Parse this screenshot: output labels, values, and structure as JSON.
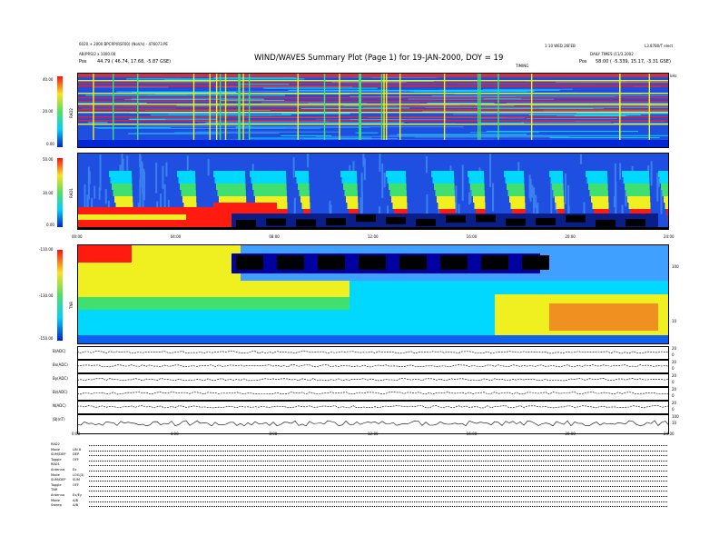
{
  "header": {
    "title": "WIND/WAVES Summary Plot (Page 1) for 19-JAN-2000, DOY = 19",
    "left_line1": "6020 + 2000 BPCRP(RSF00) (NoV/s) - 476073.PE",
    "left_line2": "AB(PRS)2 x 1000.00",
    "left_pos_label": "Pos",
    "left_pos_value": "44.79 ( 46.74, 17.68, -5.87 GSE)",
    "right_line1": "1:10 WED 26FEB",
    "right_line1b": "L3.8780/T elect",
    "right_line2": "DAILY TIMES (11/3.2002",
    "right_pos_label": "Pos",
    "right_pos_value": "58.00 ( -5.339, 15.17, -3.31 GSE)",
    "timing_label": "TIMING",
    "khz_label": "kHz"
  },
  "colors": {
    "bg_blue": "#1f4fe0",
    "deep_blue": "#0026d6",
    "cyan": "#00d8ff",
    "green": "#40e070",
    "yellow": "#f0f020",
    "red": "#ff1b10",
    "black": "#000000"
  },
  "chart_data": [
    {
      "type": "heatmap",
      "name": "RAD2",
      "ylabel": "RAD2",
      "yticks": [
        "40.00",
        "20.00",
        "0.00"
      ],
      "xticks": [
        "00:00",
        "04:00",
        "08:00",
        "12:00",
        "16:00",
        "20:00",
        "24:00"
      ]
    },
    {
      "type": "heatmap",
      "name": "RAD1",
      "ylabel": "RAD1",
      "yticks": [
        "50.00",
        "30.00",
        "0.00"
      ]
    },
    {
      "type": "heatmap",
      "name": "TNR",
      "ylabel": "TNR",
      "yticks": [
        "-110.00",
        "-130.00",
        "-150.00"
      ],
      "right_ticks": [
        "100",
        "10"
      ]
    },
    {
      "type": "line",
      "name": "magnetometer",
      "panels": [
        {
          "label": "B(ADC)",
          "right_ticks": [
            "20",
            "0"
          ]
        },
        {
          "label": "Bx(ADC)",
          "right_ticks": [
            "20",
            "0"
          ]
        },
        {
          "label": "By(ADC)",
          "right_ticks": [
            "20",
            "0"
          ]
        },
        {
          "label": "Bz(ADC)",
          "right_ticks": [
            "20",
            "0"
          ]
        },
        {
          "label": "N(ADC)",
          "right_ticks": [
            "20",
            "0"
          ]
        },
        {
          "label": "|B|(nT)",
          "right_ticks": [
            "100",
            "10"
          ]
        }
      ],
      "xticks": [
        "0:00",
        "4:00",
        "8:00",
        "12:00",
        "16:00",
        "20:00",
        "24:00"
      ]
    }
  ],
  "footer": {
    "rows": [
      {
        "label": "RAD2",
        "value": ""
      },
      {
        "label": "Mode",
        "value": "LIN 8"
      },
      {
        "label": "SUM/DEP",
        "value": "DEP"
      },
      {
        "label": "Toggle",
        "value": "OFF"
      },
      {
        "label": "RAD1",
        "value": ""
      },
      {
        "label": "Antenna",
        "value": "Ex"
      },
      {
        "label": "Mode",
        "value": "LOG(3)"
      },
      {
        "label": "SUM/DEP",
        "value": "SUM"
      },
      {
        "label": "Toggle",
        "value": "OFF"
      },
      {
        "label": "TNR",
        "value": ""
      },
      {
        "label": "Antenna",
        "value": "Ex/Ey"
      },
      {
        "label": "Mode",
        "value": "A/B"
      },
      {
        "label": "Sweep",
        "value": "A/B"
      }
    ]
  }
}
